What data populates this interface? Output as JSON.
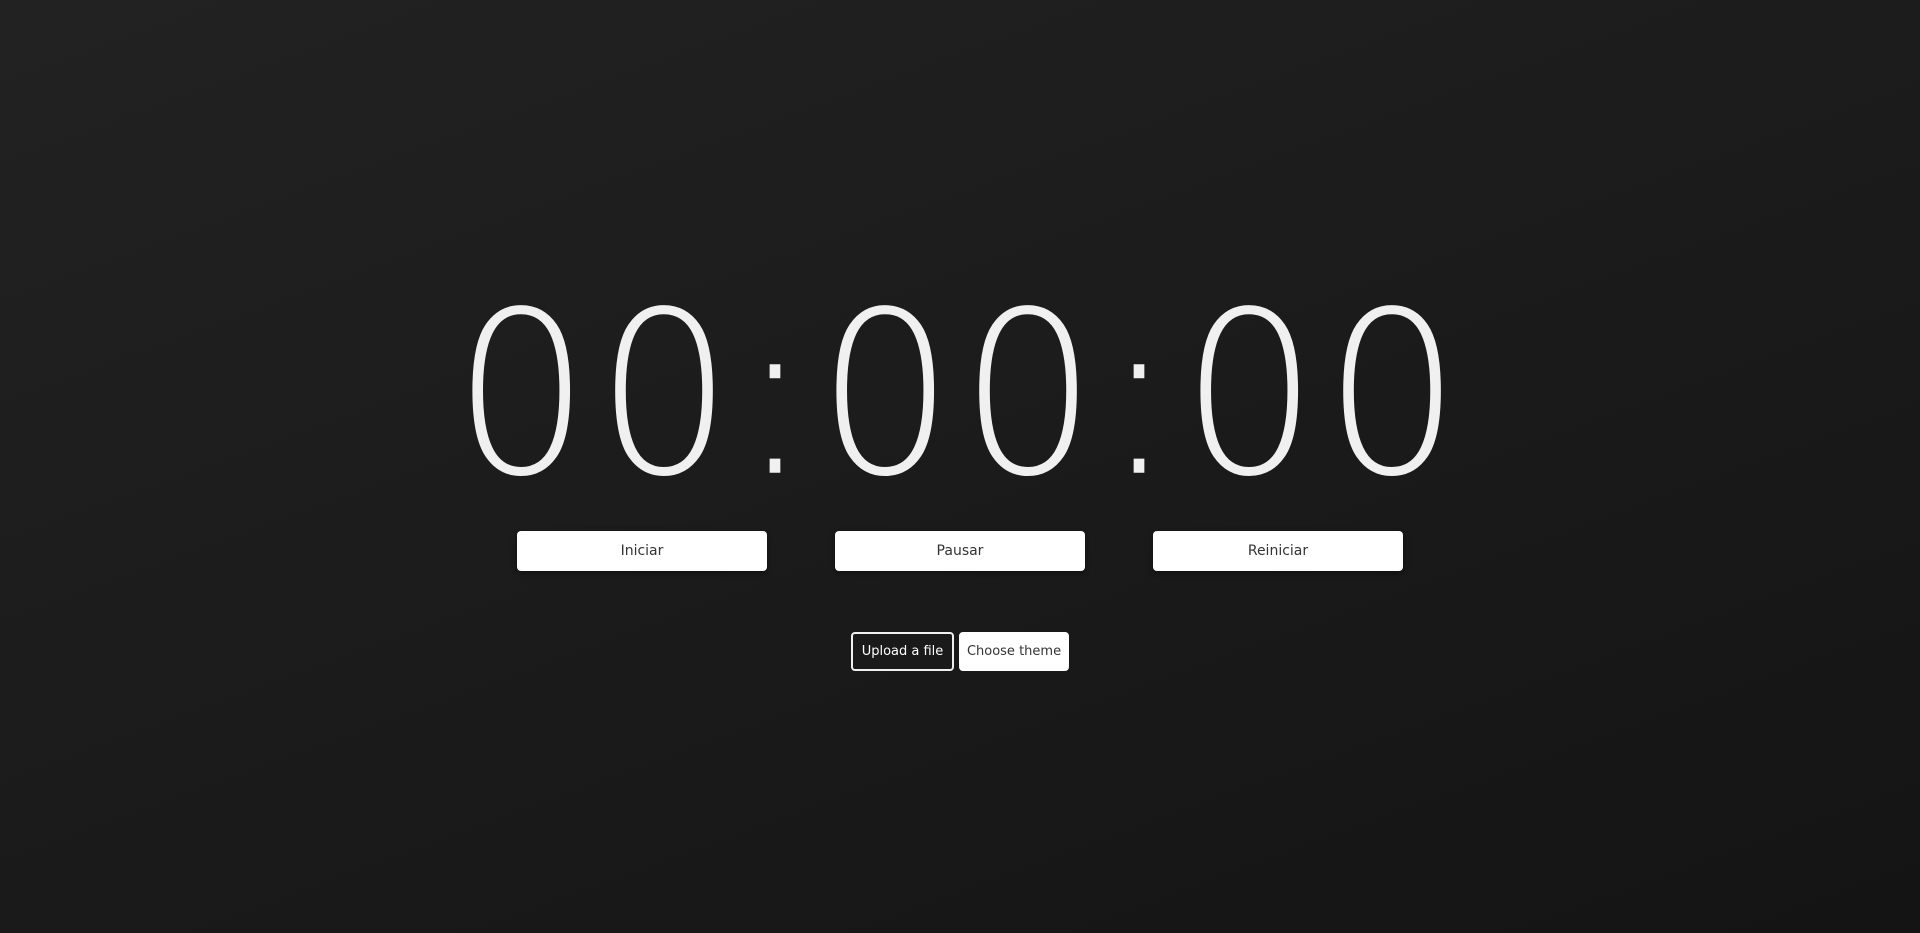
{
  "timer": {
    "chars": [
      "0",
      "0",
      ":",
      "0",
      "0",
      ":",
      "0",
      "0"
    ],
    "display": "00:00:00"
  },
  "controls": {
    "start_label": "Iniciar",
    "pause_label": "Pausar",
    "reset_label": "Reiniciar"
  },
  "extras": {
    "upload_label": "Upload a file",
    "theme_label": "Choose theme"
  },
  "colors": {
    "background": "#1b1b1b",
    "digits": "#f0f0f0",
    "button_bg": "#ffffff"
  }
}
